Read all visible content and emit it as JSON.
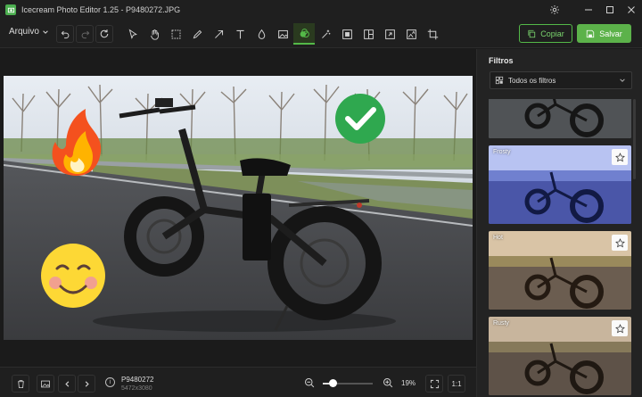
{
  "window": {
    "title": "Icecream Photo Editor 1.25 - P9480272.JPG"
  },
  "toolbar": {
    "file_menu_label": "Arquivo",
    "copy_label": "Copiar",
    "save_label": "Salvar",
    "tools": [
      "select-arrow-icon",
      "hand-icon",
      "crop-select-icon",
      "pencil-icon",
      "arrow-line-icon",
      "text-icon",
      "drop-icon",
      "image-icon",
      "filter-icon",
      "magic-wand-icon",
      "frame-icon",
      "collage-icon",
      "resize-icon",
      "sticker-icon",
      "crop-icon"
    ],
    "active_tool": "filter-icon"
  },
  "panel": {
    "title": "Filtros",
    "dropdown_value": "Todos os filtros",
    "filters": [
      {
        "label": ""
      },
      {
        "label": "Frosty"
      },
      {
        "label": "Hot"
      },
      {
        "label": "Rusty"
      }
    ]
  },
  "statusbar": {
    "file_name": "P9480272",
    "file_dims": "5472x3080",
    "zoom": "19%",
    "one_to_one": "1:1"
  },
  "colors": {
    "accent": "#5cb24a",
    "background": "#1b1b1b",
    "panel": "#232323"
  }
}
